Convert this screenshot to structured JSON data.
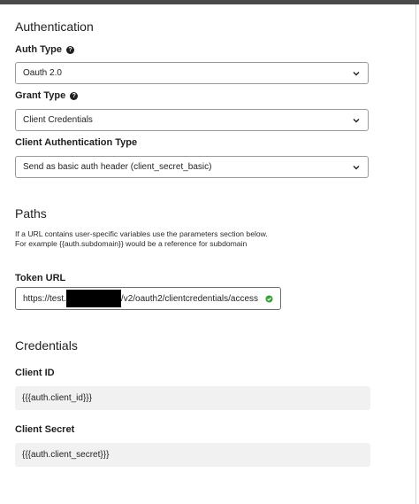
{
  "authentication": {
    "title": "Authentication",
    "auth_type": {
      "label": "Auth Type",
      "value": "Oauth 2.0",
      "help_icon": "question-circle-icon"
    },
    "grant_type": {
      "label": "Grant Type",
      "value": "Client Credentials",
      "help_icon": "question-circle-icon"
    },
    "client_auth_type": {
      "label": "Client Authentication Type",
      "value": "Send as basic auth header (client_secret_basic)"
    }
  },
  "paths": {
    "title": "Paths",
    "description": "If a URL contains user-specific variables use the parameters section below. For example {{auth.subdomain}} would be a reference for subdomain",
    "token_url": {
      "label": "Token URL",
      "value_prefix": "https://test.",
      "value_suffix": "/v2/oauth2/clientcredentials/access",
      "status_icon": "check-circle-icon",
      "status_color": "#3aa03a"
    }
  },
  "credentials": {
    "title": "Credentials",
    "client_id": {
      "label": "Client ID",
      "value": "{{{auth.client_id}}}"
    },
    "client_secret": {
      "label": "Client Secret",
      "value": "{{{auth.client_secret}}}"
    }
  }
}
